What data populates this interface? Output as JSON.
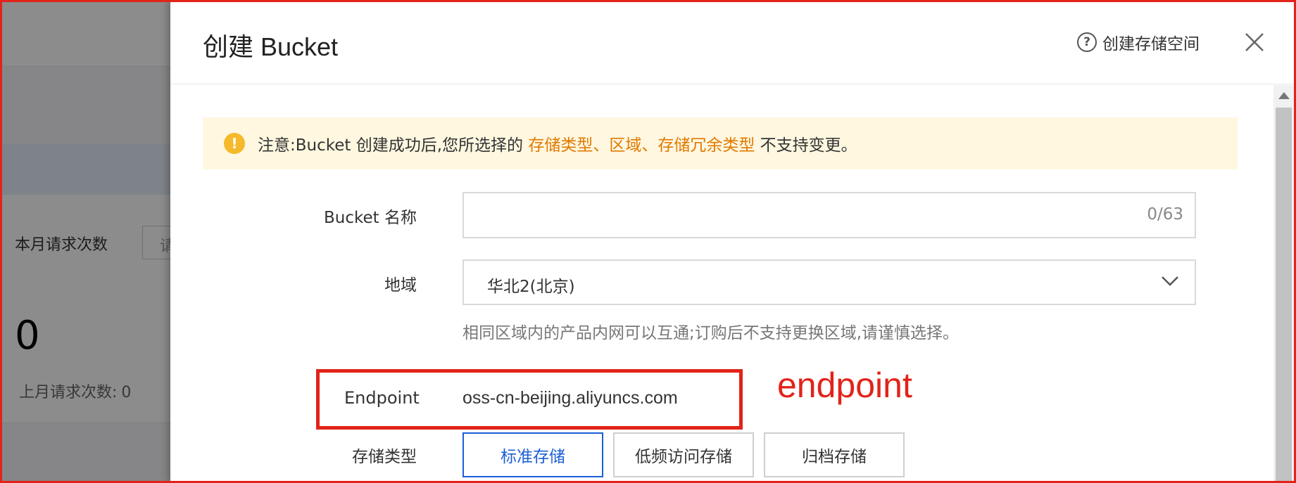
{
  "background": {
    "monthly_requests_label": "本月请求次数",
    "select_fragment": "请",
    "request_count": "0",
    "last_month_label": "上月请求次数:",
    "last_month_value": "0"
  },
  "drawer": {
    "title": "创建 Bucket",
    "help_link": "创建存储空间",
    "help_icon": "?",
    "close_icon": "close-icon"
  },
  "notice": {
    "icon": "!",
    "prefix": "注意:Bucket 创建成功后,您所选择的 ",
    "highlight1": "存储类型",
    "sep1": "、",
    "highlight2": "区域",
    "sep2": "、",
    "highlight3": "存储冗余类型",
    "suffix": " 不支持变更。"
  },
  "form": {
    "bucket_name_label": "Bucket 名称",
    "bucket_name_value": "",
    "bucket_name_counter": "0/63",
    "region_label": "地域",
    "region_value": "华北2(北京)",
    "region_hint": "相同区域内的产品内网可以互通;订购后不支持更换区域,请谨慎选择。",
    "endpoint_label": "Endpoint",
    "endpoint_value": "oss-cn-beijing.aliyuncs.com",
    "storage_class_label": "存储类型",
    "storage_classes": [
      "标准存储",
      "低频访问存储",
      "归档存储"
    ],
    "storage_class_selected": "标准存储"
  },
  "annotation": {
    "endpoint_note": "endpoint"
  },
  "colors": {
    "accent_blue": "#1b5fd6",
    "highlight_orange": "#e07a00",
    "annotation_red": "#e2231a",
    "notice_bg": "#fff7e0",
    "warning_icon": "#f5b92b"
  }
}
